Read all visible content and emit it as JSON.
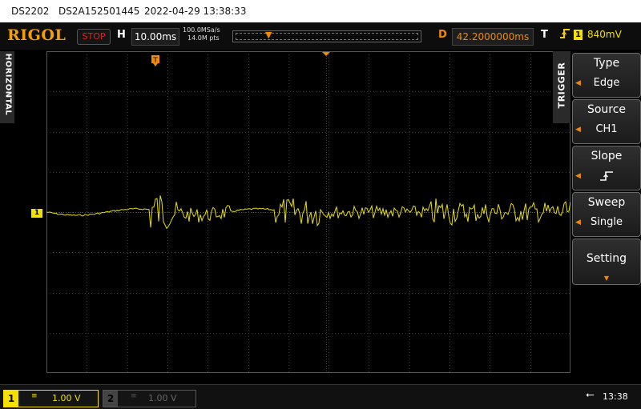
{
  "title_bar": {
    "model": "DS2202",
    "serial": "DS2A152501445",
    "datetime": "2022-04-29 13:38:33"
  },
  "toolbar": {
    "brand": "RIGOL",
    "run_state": "STOP",
    "horizontal_label": "H",
    "timebase": "10.00ms",
    "sample_rate": "100.0MSa/s",
    "memory_depth": "14.0M pts",
    "delay_label": "D",
    "delay": "42.2000000ms",
    "trigger_label": "T",
    "trigger_channel": "1",
    "trigger_level": "840mV"
  },
  "left_panel": {
    "label": "HORIZONTAL"
  },
  "channel_marker": "1",
  "trigger_menu": {
    "title": "TRIGGER",
    "items": [
      {
        "title": "Type",
        "value": "Edge"
      },
      {
        "title": "Source",
        "value": "CH1"
      },
      {
        "title": "Slope",
        "value": "rising-edge-icon"
      },
      {
        "title": "Sweep",
        "value": "Single"
      },
      {
        "title": "Setting",
        "value": ""
      }
    ]
  },
  "status_bar": {
    "ch1": {
      "number": "1",
      "coupling": "≡",
      "scale": "1.00 V"
    },
    "ch2": {
      "number": "2",
      "coupling": "≡",
      "scale": "1.00 V"
    },
    "time": "13:38"
  },
  "colors": {
    "ch1": "#f3e000",
    "accent": "#f08a00",
    "grid": "#3a3a3a",
    "stop": "#e02020"
  }
}
